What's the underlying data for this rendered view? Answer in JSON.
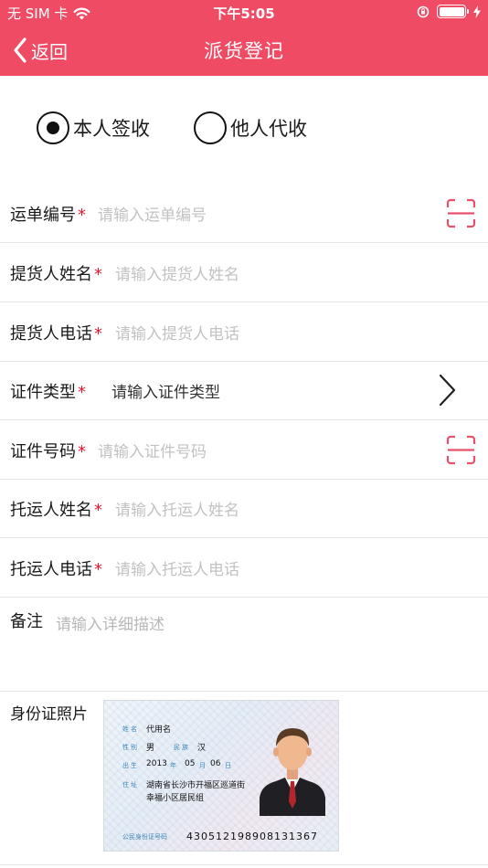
{
  "status_bar": {
    "carrier": "无 SIM 卡",
    "time": "下午5:05"
  },
  "nav": {
    "back_label": "返回",
    "title": "派货登记"
  },
  "receipt_options": [
    {
      "label": "本人签收",
      "selected": true
    },
    {
      "label": "他人代收",
      "selected": false
    }
  ],
  "form": {
    "waybill": {
      "label": "运单编号",
      "required": "*",
      "placeholder": "请输入运单编号"
    },
    "pickup_name": {
      "label": "提货人姓名",
      "required": "*",
      "placeholder": "请输入提货人姓名"
    },
    "pickup_phone": {
      "label": "提货人电话",
      "required": "*",
      "placeholder": "请输入提货人电话"
    },
    "id_type": {
      "label": "证件类型",
      "required": "*",
      "placeholder": "请输入证件类型"
    },
    "id_number": {
      "label": "证件号码",
      "required": "*",
      "placeholder": "请输入证件号码"
    },
    "shipper_name": {
      "label": "托运人姓名",
      "required": "*",
      "placeholder": "请输入托运人姓名"
    },
    "shipper_phone": {
      "label": "托运人电话",
      "required": "*",
      "placeholder": "请输入托运人电话"
    },
    "remark": {
      "label": "备注",
      "placeholder": "请输入详细描述"
    },
    "id_photo": {
      "label": "身份证照片"
    }
  },
  "id_card": {
    "name_key": "姓名",
    "name": "代用名",
    "sex_key": "性别",
    "sex": "男",
    "ethnic_key": "民族",
    "ethnic": "汉",
    "birth_key": "出生",
    "birth_year": "2013",
    "year_unit": "年",
    "birth_month": "05",
    "month_unit": "月",
    "birth_day": "06",
    "day_unit": "日",
    "address_key": "住址",
    "address_line1": "湖南省长沙市开福区巡道街",
    "address_line2": "幸福小区居民组",
    "id_key": "公民身份证号码",
    "id_number": "430512198908131367"
  },
  "colors": {
    "header": "#f04b65",
    "required_star": "#e8162e",
    "scan_icon": "#e8516a",
    "placeholder": "#c2c2c2"
  },
  "icons": [
    "wifi-icon",
    "lock-rotation-icon",
    "battery-icon",
    "charging-icon",
    "back-chevron-icon",
    "scan-icon",
    "chevron-right-icon"
  ]
}
